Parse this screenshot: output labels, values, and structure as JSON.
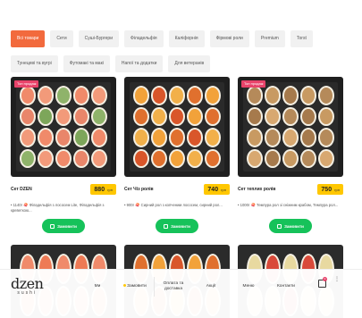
{
  "filters": {
    "row1": [
      "Всі товари",
      "Сети",
      "Суші-Бургери",
      "Філадельфія",
      "Каліфорнія",
      "Фірмові роли",
      "Premium",
      "Тоrst"
    ],
    "row2": [
      "Тунецеві та вугрі",
      "Футомакі та макі",
      "Напої та додатки",
      "Для ветеранів"
    ]
  },
  "products": [
    {
      "badge": "Топ продаж",
      "name": "Сет DZEN",
      "price": "880",
      "currency": "грн",
      "desc": "• 1140г 🍣 Філадельфія з лососем Lite, Філадельфія з креветкою...",
      "order_label": "Замовити"
    },
    {
      "badge": "",
      "name": "Сет Чіз ролів",
      "price": "740",
      "currency": "грн",
      "desc": "• 900г 🍣 Сирний рол з копченим лососем, сирний рол...",
      "order_label": "Замовити"
    },
    {
      "badge": "Топ продаж",
      "name": "Сет теплих ролів",
      "price": "750",
      "currency": "грн",
      "desc": "• 1000г 🍣 Темпура рол зі сніжним крабом, Темпура рол...",
      "order_label": "Замовити"
    }
  ],
  "nav": {
    "logo": "dzen",
    "logo_sub": "sushi",
    "items": [
      "Ми",
      "Замовити",
      "Оплата та доставка",
      "Акції",
      "Меню",
      "Контакти"
    ],
    "cart_count": "0"
  },
  "colors": {
    "accent": "#f26a3d",
    "price": "#ffc700",
    "button": "#16c25a",
    "badge": "#e8436a"
  }
}
